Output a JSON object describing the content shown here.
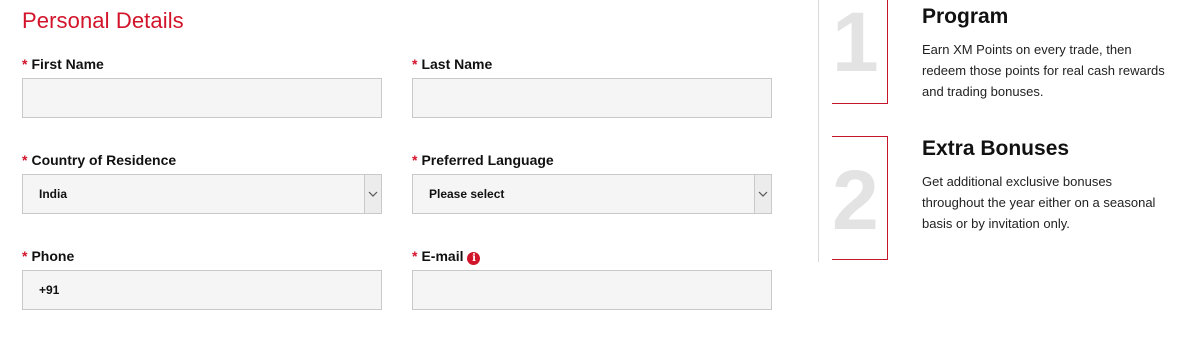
{
  "form": {
    "section_title": "Personal Details",
    "required_marker": "*",
    "fields": {
      "first_name": {
        "label": "First Name",
        "value": ""
      },
      "last_name": {
        "label": "Last Name",
        "value": ""
      },
      "country": {
        "label": "Country of Residence",
        "value": "India"
      },
      "language": {
        "label": "Preferred Language",
        "value": "Please select"
      },
      "phone": {
        "label": "Phone",
        "value": "+91"
      },
      "email": {
        "label": "E-mail",
        "value": "",
        "info_icon": "info-icon"
      }
    }
  },
  "benefits": {
    "items": [
      {
        "number": "1",
        "title": "Program",
        "description": "Earn XM Points on every trade, then redeem those points for real cash rewards and trading bonuses."
      },
      {
        "number": "2",
        "title": "Extra Bonuses",
        "description": "Get additional exclusive bonuses throughout the year either on a seasonal basis or by invitation only."
      }
    ]
  },
  "colors": {
    "accent": "#d2142a",
    "field_bg": "#f5f5f5",
    "field_border": "#c9c9c9",
    "step_number": "#e3e3e3"
  }
}
